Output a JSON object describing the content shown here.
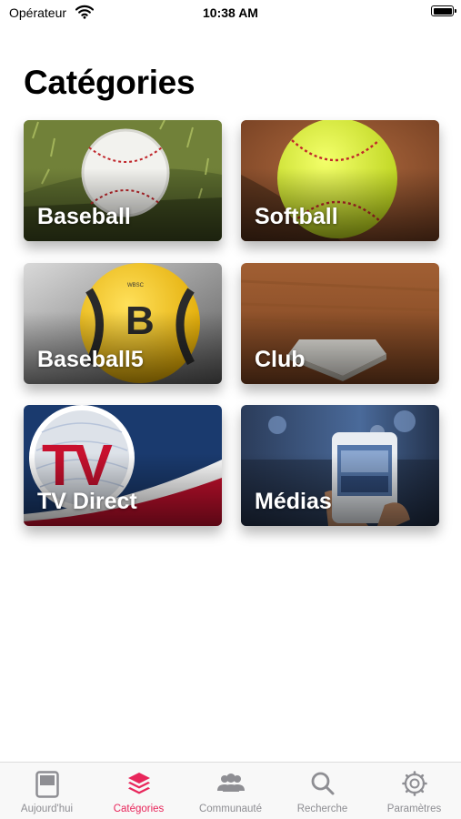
{
  "status_bar": {
    "carrier": "Opérateur",
    "time": "10:38 AM"
  },
  "page": {
    "title": "Catégories"
  },
  "categories": [
    {
      "label": "Baseball"
    },
    {
      "label": "Softball"
    },
    {
      "label": "Baseball5"
    },
    {
      "label": "Club"
    },
    {
      "label": "TV Direct",
      "logo_text": "TV"
    },
    {
      "label": "Médias"
    }
  ],
  "baseball5_ball_text": {
    "brand": "WBSC",
    "mark": "B"
  },
  "tabbar": {
    "active_color": "#e8265b",
    "inactive_color": "#8e8e93",
    "items": [
      {
        "label": "Aujourd'hui",
        "icon": "today-icon"
      },
      {
        "label": "Catégories",
        "icon": "layers-icon",
        "active": true
      },
      {
        "label": "Communauté",
        "icon": "people-icon"
      },
      {
        "label": "Recherche",
        "icon": "search-icon"
      },
      {
        "label": "Paramètres",
        "icon": "gear-icon"
      }
    ]
  }
}
